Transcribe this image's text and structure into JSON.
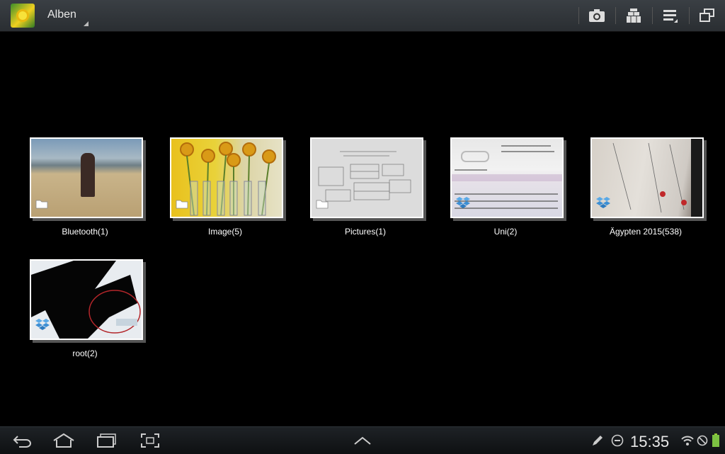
{
  "header": {
    "title": "Alben",
    "actions": [
      {
        "name": "camera-icon",
        "label": ""
      },
      {
        "name": "group-by-icon",
        "label": ""
      },
      {
        "name": "menu-icon",
        "label": ""
      },
      {
        "name": "multi-window-icon",
        "label": ""
      }
    ]
  },
  "albums": [
    {
      "label": "Bluetooth(1)",
      "badge": "folder-icon"
    },
    {
      "label": "Image(5)",
      "badge": "folder-icon"
    },
    {
      "label": "Pictures(1)",
      "badge": "folder-icon"
    },
    {
      "label": "Uni(2)",
      "badge": "dropbox-icon"
    },
    {
      "label": "Ägypten 2015(538)",
      "badge": "dropbox-icon"
    },
    {
      "label": "root(2)",
      "badge": "dropbox-icon"
    }
  ],
  "statusbar": {
    "time": "15:35"
  },
  "colors": {
    "accent": "#33b5e5",
    "background": "#000000"
  }
}
